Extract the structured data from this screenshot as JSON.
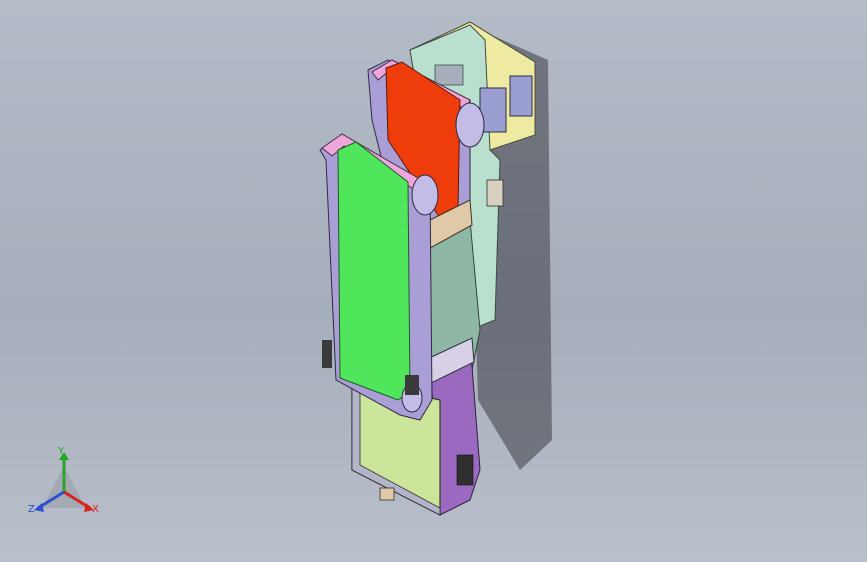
{
  "viewport": {
    "background_top": "#b4bcc8",
    "background_bottom": "#b9c0cb"
  },
  "model": {
    "colors": {
      "bracket_yellow": "#efeaa2",
      "bracket_mint": "#b9e0cf",
      "belt_red": "#ee3d0a",
      "belt_green": "#4fe65c",
      "frame_violet": "#a99fd6",
      "frame_pink": "#f0a6dc",
      "plate_teal": "#8fb7a6",
      "plate_lime": "#cde59a",
      "slide_purple": "#9b6ac0",
      "plate_tan": "#e0c9a8"
    }
  },
  "triad": {
    "y_label": "Y",
    "x_label": "X",
    "z_label": "Z",
    "y_color": "#26a626",
    "x_color": "#d9231f",
    "z_color": "#2a4fcf"
  }
}
